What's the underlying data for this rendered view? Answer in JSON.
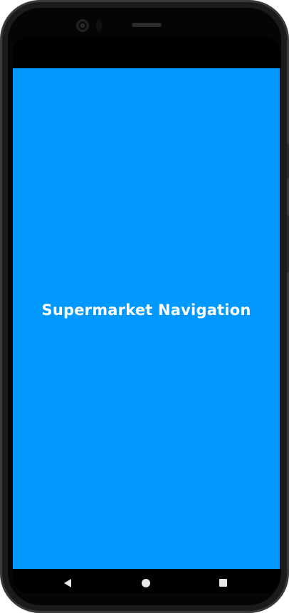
{
  "app": {
    "title": "Supermarket Navigation",
    "background_color": "#0299fe",
    "text_color": "#ffffff"
  },
  "device": {
    "frame_color": "#1b1b1b",
    "nav_icons": [
      "back-triangle-icon",
      "home-circle-icon",
      "recents-square-icon"
    ]
  }
}
